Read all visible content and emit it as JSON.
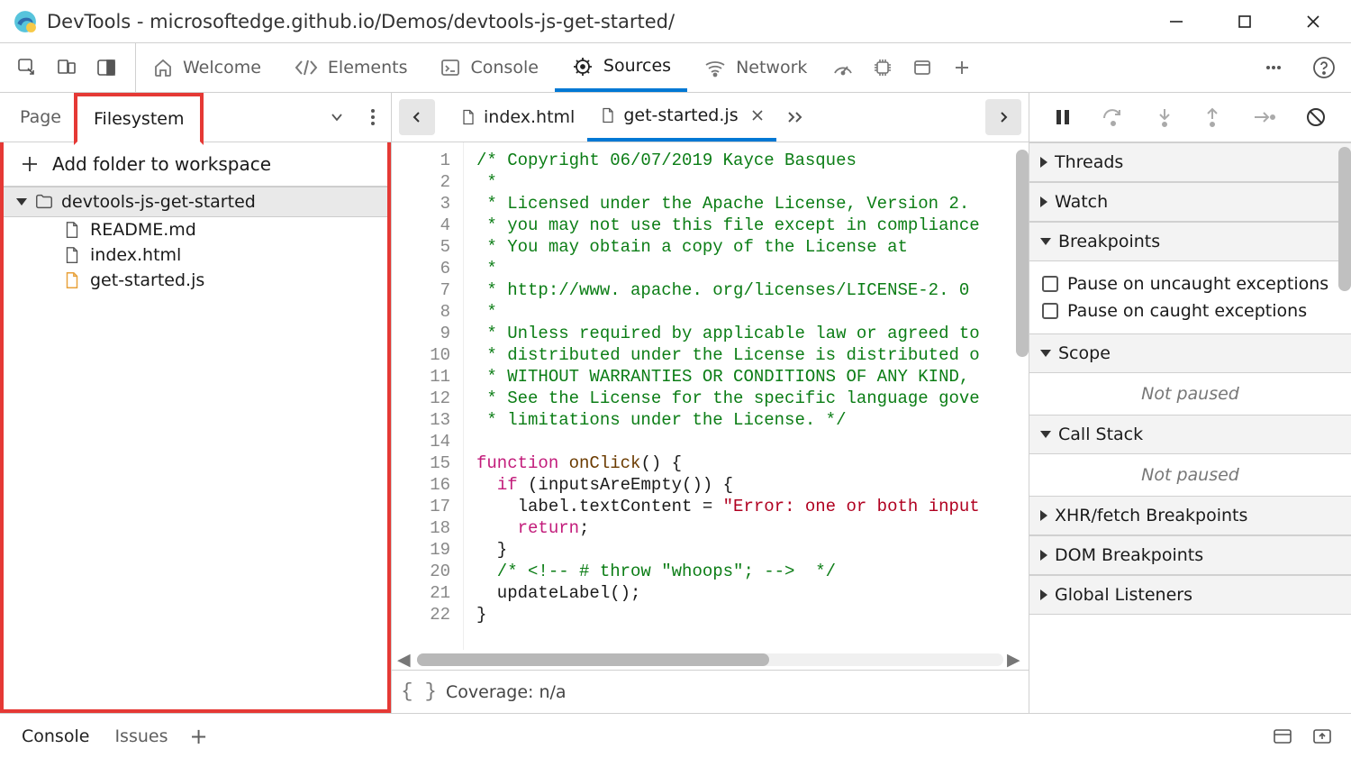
{
  "window": {
    "title": "DevTools - microsoftedge.github.io/Demos/devtools-js-get-started/"
  },
  "toolbar": {
    "tabs": [
      {
        "label": "Welcome",
        "active": false
      },
      {
        "label": "Elements",
        "active": false
      },
      {
        "label": "Console",
        "active": false
      },
      {
        "label": "Sources",
        "active": true
      },
      {
        "label": "Network",
        "active": false
      }
    ]
  },
  "left": {
    "tabs": {
      "page": "Page",
      "filesystem": "Filesystem"
    },
    "add_folder": "Add folder to workspace",
    "root_folder": "devtools-js-get-started",
    "files": [
      {
        "name": "README.md",
        "kind": "file"
      },
      {
        "name": "index.html",
        "kind": "file"
      },
      {
        "name": "get-started.js",
        "kind": "js"
      }
    ]
  },
  "center": {
    "files": {
      "index": "index.html",
      "getstarted": "get-started.js"
    },
    "code_comment": "/* Copyright 06/07/2019 Kayce Basques\n *\n * Licensed under the Apache License, Version 2.\n * you may not use this file except in compliance\n * You may obtain a copy of the License at\n *\n * http://www. apache. org/licenses/LICENSE-2. 0\n *\n * Unless required by applicable law or agreed to\n * distributed under the License is distributed o\n * WITHOUT WARRANTIES OR CONDITIONS OF ANY KIND,\n * See the License for the specific language gove\n * limitations under the License. */",
    "line15": {
      "kw": "function",
      "fn": "onClick",
      "rest": "() {"
    },
    "line16": {
      "kw": "if",
      "rest": " (inputsAreEmpty()) {"
    },
    "line17": {
      "lhs": "    label.textContent = ",
      "str": "\"Error: one or both input"
    },
    "line18": {
      "kw": "return",
      "rest": ";"
    },
    "line19": "  }",
    "line20_comment": "  /* <!-- # throw \"whoops\"; -->  */",
    "line21": "  updateLabel();",
    "line22": "}",
    "coverage": "Coverage: n/a"
  },
  "right": {
    "sections": {
      "threads": "Threads",
      "watch": "Watch",
      "breakpoints": "Breakpoints",
      "scope": "Scope",
      "callstack": "Call Stack",
      "xhr": "XHR/fetch Breakpoints",
      "dom": "DOM Breakpoints",
      "global": "Global Listeners"
    },
    "bp_uncaught": "Pause on uncaught exceptions",
    "bp_caught": "Pause on caught exceptions",
    "not_paused": "Not paused"
  },
  "drawer": {
    "console": "Console",
    "issues": "Issues"
  }
}
